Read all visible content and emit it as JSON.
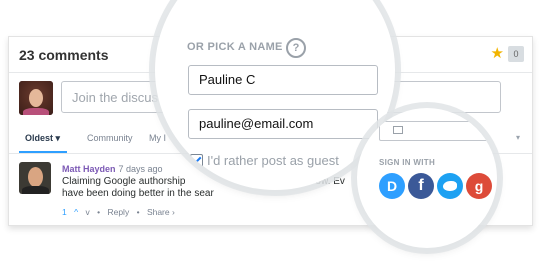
{
  "comments_header": {
    "title": "23 comments",
    "badge_count": "0"
  },
  "composer": {
    "placeholder": "Join the discus"
  },
  "tabs": [
    {
      "label": "Oldest",
      "active": true
    },
    {
      "label": "Community",
      "active": false
    },
    {
      "label": "My I",
      "active": false
    }
  ],
  "comment": {
    "author": "Matt Hayden",
    "time": "· 7 days ago",
    "text_line1": "Claiming Google authorship",
    "text_line1_tail": "ow. Ev",
    "text_line2": "have been doing better in the sear",
    "actions": {
      "upvotes": "1",
      "up_icon": "^",
      "down_icon": "v",
      "reply": "Reply",
      "share": "Share ›"
    }
  },
  "guest_form": {
    "pick_name_label": "OR PICK A NAME",
    "help_icon": "?",
    "name_value": "Pauline C",
    "email_value": "pauline@email.com",
    "guest_checkbox_label": "I'd rather post as guest",
    "guest_checked": true
  },
  "signin": {
    "label": "SIGN IN WITH",
    "providers": [
      {
        "name": "Disqus",
        "glyph": "D",
        "color": "#2e9fff"
      },
      {
        "name": "Facebook",
        "glyph": "f",
        "color": "#3b5998"
      },
      {
        "name": "Twitter",
        "glyph": "",
        "color": "#1da1f2"
      },
      {
        "name": "Google",
        "glyph": "g",
        "color": "#dd4b39"
      }
    ]
  }
}
